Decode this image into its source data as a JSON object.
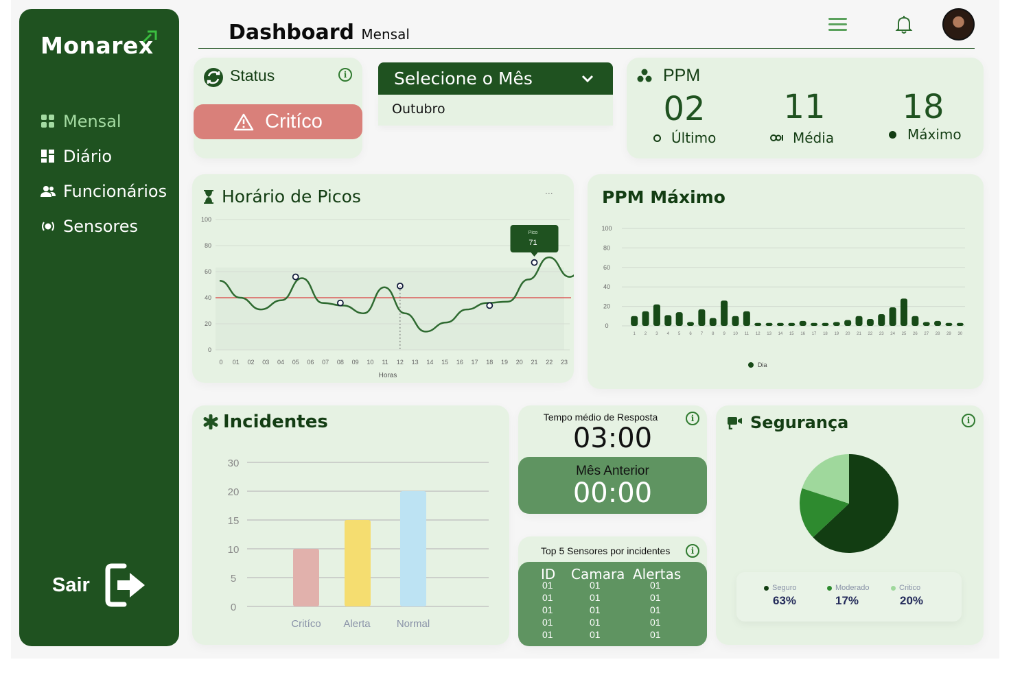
{
  "app": {
    "logo": "Monarex",
    "colors": {
      "sidebar": "#1f5220",
      "accent": "#a4dba2",
      "critical": "#d9807a",
      "card": "#e6f2e3"
    }
  },
  "sidebar": {
    "items": [
      {
        "label": "Mensal",
        "icon": "grid-icon",
        "active": true
      },
      {
        "label": "Diário",
        "icon": "dashboard-icon",
        "active": false
      },
      {
        "label": "Funcionários",
        "icon": "users-icon",
        "active": false
      },
      {
        "label": "Sensores",
        "icon": "sensor-icon",
        "active": false
      }
    ],
    "logout_label": "Sair"
  },
  "header": {
    "title": "Dashboard",
    "subtitle": "Mensal"
  },
  "status": {
    "title": "Status",
    "value": "Critíco"
  },
  "month_select": {
    "label": "Selecione o Mês",
    "value": "Outubro"
  },
  "ppm": {
    "title": "PPM",
    "stats": [
      {
        "value": "02",
        "label": "Último"
      },
      {
        "value": "11",
        "label": "Média"
      },
      {
        "value": "18",
        "label": "Máximo"
      }
    ]
  },
  "peak_hours": {
    "title": "Horário de Picos",
    "menu": "...",
    "tooltip_label": "Pico",
    "tooltip_value": "71"
  },
  "ppm_max": {
    "title": "PPM Máximo",
    "legend": "Dia"
  },
  "incidents": {
    "title": "Incidentes"
  },
  "response": {
    "label": "Tempo médio de Resposta",
    "value": "03:00",
    "prev_label": "Mês Anterior",
    "prev_value": "00:00"
  },
  "top5": {
    "label": "Top 5 Sensores por incidentes",
    "headers": [
      "ID",
      "Camara",
      "Alertas"
    ],
    "rows": [
      [
        "01",
        "01",
        "01"
      ],
      [
        "01",
        "01",
        "01"
      ],
      [
        "01",
        "01",
        "01"
      ],
      [
        "01",
        "01",
        "01"
      ],
      [
        "01",
        "01",
        "01"
      ]
    ]
  },
  "security": {
    "title": "Segurança",
    "legend": [
      {
        "label": "Seguro",
        "value": "63%",
        "color": "#123d12"
      },
      {
        "label": "Moderado",
        "value": "17%",
        "color": "#2e8a2f"
      },
      {
        "label": "Critico",
        "value": "20%",
        "color": "#9fd89c"
      }
    ]
  },
  "chart_data": [
    {
      "type": "line",
      "xlabel": "Horas",
      "x": [
        "0",
        "01",
        "02",
        "03",
        "04",
        "05",
        "06",
        "07",
        "08",
        "09",
        "10",
        "11",
        "12",
        "13",
        "14",
        "15",
        "16",
        "17",
        "18",
        "19",
        "20",
        "21",
        "22",
        "23"
      ],
      "values": [
        53,
        40,
        31,
        38,
        55,
        36,
        34,
        28,
        48,
        28,
        14,
        21,
        31,
        36,
        37,
        54,
        71,
        56,
        72
      ],
      "ylim": [
        0,
        100
      ],
      "yticks": [
        0,
        20,
        40,
        60,
        80,
        100
      ],
      "threshold": 40,
      "threshold_color": "#d94040",
      "marked_points": [
        {
          "x": "05",
          "y": 56
        },
        {
          "x": "08",
          "y": 36
        },
        {
          "x": "12",
          "y": 49
        },
        {
          "x": "18",
          "y": 34
        },
        {
          "x": "21",
          "y": 67
        }
      ],
      "grid": true
    },
    {
      "type": "bar",
      "categories": [
        "1",
        "2",
        "3",
        "4",
        "5",
        "6",
        "7",
        "8",
        "9",
        "10",
        "11",
        "12",
        "13",
        "14",
        "15",
        "16",
        "17",
        "18",
        "19",
        "20",
        "21",
        "22",
        "23",
        "24",
        "25",
        "26",
        "27",
        "28",
        "29",
        "30"
      ],
      "series": [
        {
          "values": [
            10,
            15,
            22,
            11,
            14,
            4,
            17,
            8,
            26,
            10,
            15,
            3,
            3,
            3,
            3,
            5,
            3,
            3,
            4,
            6,
            10,
            7,
            12,
            19,
            28,
            10,
            4,
            5,
            3,
            3
          ]
        }
      ],
      "ylim": [
        0,
        100
      ],
      "yticks": [
        0,
        20,
        40,
        60,
        80,
        100
      ],
      "grid": true,
      "legend": "bottom-center"
    },
    {
      "type": "bar",
      "categories": [
        "Critíco",
        "Alerta",
        "Normal"
      ],
      "values": [
        10,
        15,
        20
      ],
      "colors": [
        "#e1b1ac",
        "#f5dd70",
        "#bde3f3"
      ],
      "yticks": [
        "0",
        "5",
        "10",
        "15",
        "20",
        "30"
      ]
    },
    {
      "type": "pie",
      "categories": [
        "Seguro",
        "Moderado",
        "Critico"
      ],
      "values": [
        63,
        17,
        20
      ],
      "colors": [
        "#123d12",
        "#2e8a2f",
        "#9fd89c"
      ]
    }
  ]
}
